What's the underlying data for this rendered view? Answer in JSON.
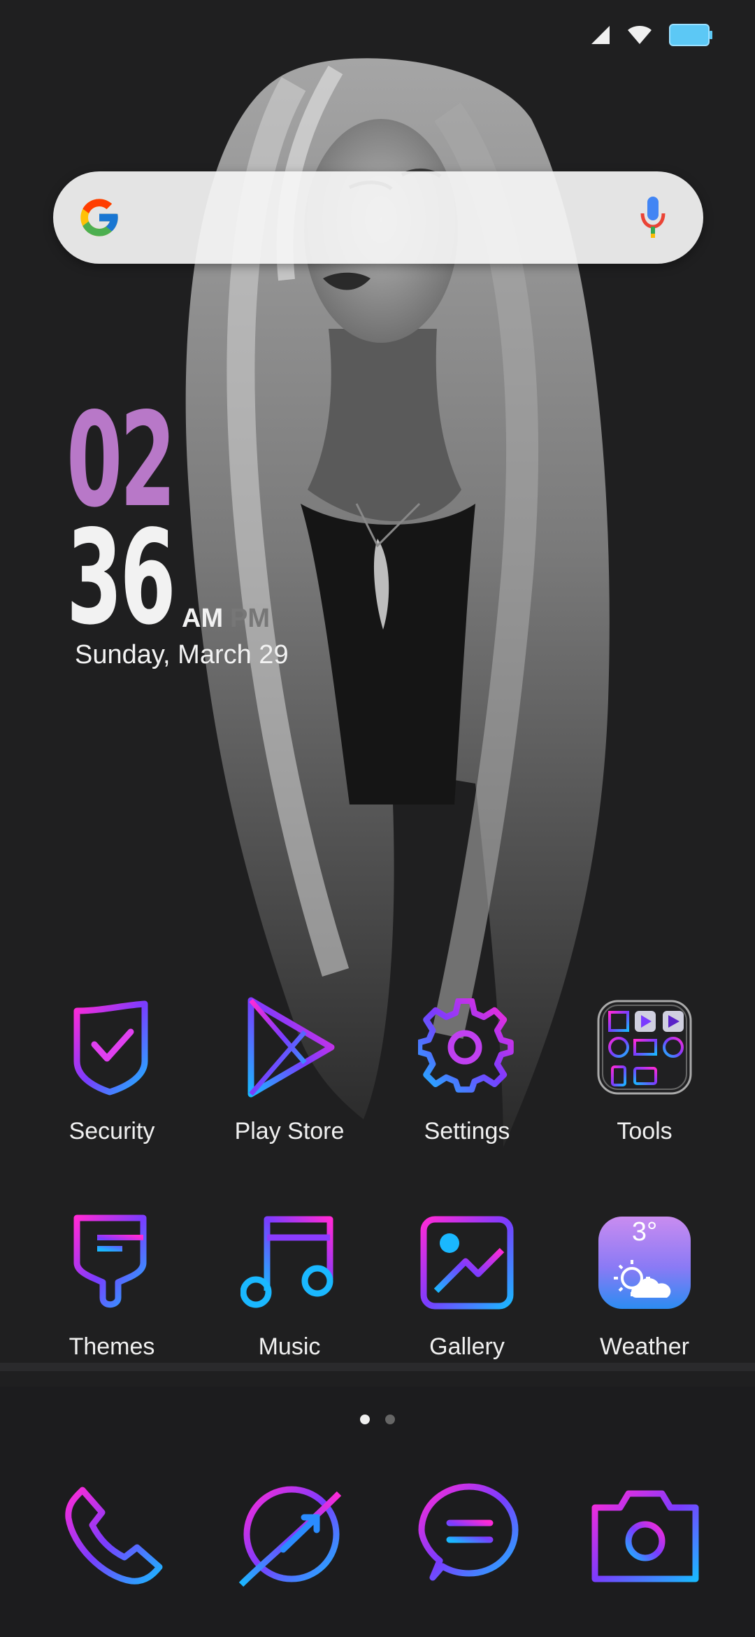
{
  "status_bar": {
    "icons": [
      "signal-icon",
      "wifi-icon",
      "battery-icon"
    ],
    "battery_color": "#5cc8f5"
  },
  "search": {
    "placeholder": "",
    "icons": [
      "google-logo-icon",
      "microphone-icon"
    ]
  },
  "clock": {
    "hour": "02",
    "minute": "36",
    "am_label": "AM",
    "pm_label": "PM",
    "date": "Sunday, March 29",
    "hour_color": "#b878c8"
  },
  "apps_row1": [
    {
      "label": "Security",
      "icon": "shield-check-icon"
    },
    {
      "label": "Play Store",
      "icon": "play-store-icon"
    },
    {
      "label": "Settings",
      "icon": "gear-icon"
    },
    {
      "label": "Tools",
      "icon": "folder-icon"
    }
  ],
  "apps_row2": [
    {
      "label": "Themes",
      "icon": "paintbrush-icon"
    },
    {
      "label": "Music",
      "icon": "music-note-icon"
    },
    {
      "label": "Gallery",
      "icon": "image-icon"
    },
    {
      "label": "Weather",
      "icon": "weather-icon",
      "temperature": "3°"
    }
  ],
  "page_indicator": {
    "pages": 2,
    "active": 1
  },
  "dock": [
    {
      "icon": "phone-icon"
    },
    {
      "icon": "browser-icon"
    },
    {
      "icon": "messages-icon"
    },
    {
      "icon": "camera-icon"
    }
  ],
  "colors": {
    "gradient_start": "#ff2ad6",
    "gradient_mid": "#7a3cff",
    "gradient_end": "#1ab8ff",
    "background": "#1e1e1f"
  }
}
